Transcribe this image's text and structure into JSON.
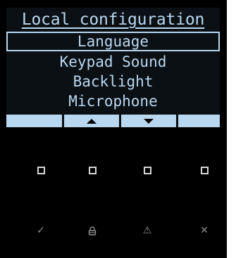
{
  "screen": {
    "title": "Local configuration",
    "menu": [
      {
        "label": "Language",
        "selected": true
      },
      {
        "label": "Keypad Sound",
        "selected": false
      },
      {
        "label": "Backlight",
        "selected": false
      },
      {
        "label": "Microphone",
        "selected": false
      }
    ],
    "softkeys": [
      {
        "icon": "none"
      },
      {
        "icon": "arrow-up-icon"
      },
      {
        "icon": "arrow-down-icon"
      },
      {
        "icon": "none"
      }
    ]
  },
  "hardware_buttons": {
    "top_row": [
      "softkey-button-1",
      "softkey-button-2",
      "softkey-button-3",
      "softkey-button-4"
    ],
    "bottom_row": [
      {
        "name": "ok-button",
        "glyph": "✓"
      },
      {
        "name": "lock-button",
        "glyph": "🔒"
      },
      {
        "name": "alarm-button",
        "glyph": "⚠"
      },
      {
        "name": "cancel-button",
        "glyph": "✕"
      }
    ]
  },
  "colors": {
    "lcd_text": "#b9d7ef",
    "lcd_background": "#0b1015",
    "device_body": "#000000"
  }
}
